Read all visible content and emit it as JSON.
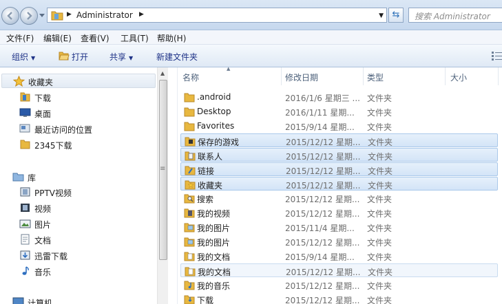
{
  "address_bar": {
    "crumbs": [
      "Administrator"
    ],
    "search_placeholder": "搜索 Administrator"
  },
  "menu": [
    "文件(F)",
    "编辑(E)",
    "查看(V)",
    "工具(T)",
    "帮助(H)"
  ],
  "toolbar": {
    "organize": "组织",
    "open": "打开",
    "share": "共享",
    "new_folder": "新建文件夹"
  },
  "nav": {
    "favorites_label": "收藏夹",
    "favorites": [
      {
        "label": "下载",
        "icon": "download-folder-icon"
      },
      {
        "label": "桌面",
        "icon": "desktop-icon"
      },
      {
        "label": "最近访问的位置",
        "icon": "recent-places-icon"
      },
      {
        "label": "2345下载",
        "icon": "folder-icon"
      }
    ],
    "libraries_label": "库",
    "libraries": [
      {
        "label": "PPTV视频",
        "icon": "video-library-icon"
      },
      {
        "label": "视频",
        "icon": "video-library-icon"
      },
      {
        "label": "图片",
        "icon": "pictures-library-icon"
      },
      {
        "label": "文档",
        "icon": "documents-library-icon"
      },
      {
        "label": "迅雷下载",
        "icon": "download-library-icon"
      },
      {
        "label": "音乐",
        "icon": "music-library-icon"
      }
    ],
    "computer_label": "计算机"
  },
  "columns": {
    "name": "名称",
    "date": "修改日期",
    "type": "类型",
    "size": "大小"
  },
  "files": [
    {
      "name": ".android",
      "date": "2016/1/6 星期三 ...",
      "type": "文件夹",
      "icon": "folder-icon",
      "state": "normal"
    },
    {
      "name": "Desktop",
      "date": "2016/1/11 星期...",
      "type": "文件夹",
      "icon": "folder-icon",
      "state": "normal"
    },
    {
      "name": "Favorites",
      "date": "2015/9/14 星期...",
      "type": "文件夹",
      "icon": "folder-icon",
      "state": "normal"
    },
    {
      "name": "保存的游戏",
      "date": "2015/12/12 星期...",
      "type": "文件夹",
      "icon": "saved-games-folder-icon",
      "state": "selected"
    },
    {
      "name": "联系人",
      "date": "2015/12/12 星期...",
      "type": "文件夹",
      "icon": "contacts-folder-icon",
      "state": "selected"
    },
    {
      "name": "链接",
      "date": "2015/12/12 星期...",
      "type": "文件夹",
      "icon": "links-folder-icon",
      "state": "selected"
    },
    {
      "name": "收藏夹",
      "date": "2015/12/12 星期...",
      "type": "文件夹",
      "icon": "favorites-folder-icon",
      "state": "selected"
    },
    {
      "name": "搜索",
      "date": "2015/12/12 星期...",
      "type": "文件夹",
      "icon": "searches-folder-icon",
      "state": "normal"
    },
    {
      "name": "我的视频",
      "date": "2015/12/12 星期...",
      "type": "文件夹",
      "icon": "videos-folder-icon",
      "state": "normal"
    },
    {
      "name": "我的图片",
      "date": "2015/11/4 星期...",
      "type": "文件夹",
      "icon": "pictures-folder-icon",
      "state": "normal"
    },
    {
      "name": "我的图片",
      "date": "2015/12/12 星期...",
      "type": "文件夹",
      "icon": "pictures-folder-icon",
      "state": "normal"
    },
    {
      "name": "我的文档",
      "date": "2015/9/14 星期...",
      "type": "文件夹",
      "icon": "documents-folder-icon",
      "state": "normal"
    },
    {
      "name": "我的文档",
      "date": "2015/12/12 星期...",
      "type": "文件夹",
      "icon": "documents-folder-icon",
      "state": "hover"
    },
    {
      "name": "我的音乐",
      "date": "2015/12/12 星期...",
      "type": "文件夹",
      "icon": "music-folder-icon",
      "state": "normal"
    },
    {
      "name": "下载",
      "date": "2015/12/12 星期...",
      "type": "文件夹",
      "icon": "downloads-folder-icon",
      "state": "normal"
    }
  ],
  "colors": {
    "folder": "#e8b840",
    "selection": "#cfe3f8",
    "link": "#1e3287"
  }
}
